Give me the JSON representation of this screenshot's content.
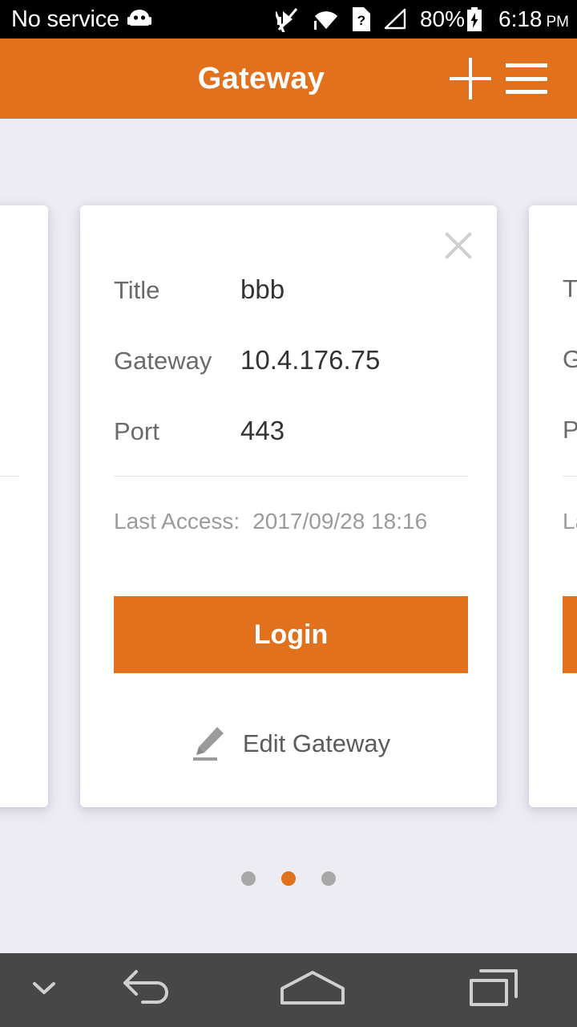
{
  "statusbar": {
    "carrier": "No service",
    "android_icon": "android-robot-icon",
    "icons": [
      "vibrate-off-icon",
      "wifi-icon",
      "sim-unknown-icon",
      "signal-icon"
    ],
    "battery_percent": "80%",
    "battery_icon": "battery-charging-icon",
    "time": "6:18",
    "ampm": "PM"
  },
  "appbar": {
    "title": "Gateway",
    "add_icon": "plus-icon",
    "menu_icon": "hamburger-menu-icon"
  },
  "card": {
    "close_icon": "close-icon",
    "fields": [
      {
        "label": "Title",
        "value": "bbb"
      },
      {
        "label": "Gateway",
        "value": "10.4.176.75"
      },
      {
        "label": "Port",
        "value": "443"
      }
    ],
    "last_access_label": "Last Access:",
    "last_access_value": "2017/09/28 18:16",
    "login_label": "Login",
    "edit_label": "Edit Gateway",
    "edit_icon": "pencil-edit-icon"
  },
  "side_cards": {
    "left": {
      "fields": [
        {
          "label": "",
          "value": ""
        },
        {
          "label": "",
          "value": ""
        },
        {
          "label": "",
          "value": ""
        }
      ]
    },
    "right": {
      "fields": [
        {
          "label": "T",
          "value": ""
        },
        {
          "label": "G",
          "value": ""
        },
        {
          "label": "P",
          "value": ""
        }
      ],
      "last_access_label": "La"
    }
  },
  "pager": {
    "total": 3,
    "active_index": 1,
    "active_color": "#e2711d",
    "inactive_color": "#a8a8a8"
  },
  "navbar": {
    "hide_icon": "chevron-down-icon",
    "back_icon": "back-arrow-icon",
    "home_icon": "home-icon",
    "recents_icon": "recent-apps-icon"
  },
  "colors": {
    "accent": "#e2711d",
    "background": "#edecf2",
    "card": "#ffffff",
    "navbar": "#474747",
    "statusbar": "#000000"
  }
}
